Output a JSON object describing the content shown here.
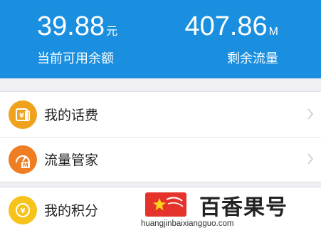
{
  "balance": {
    "value": "39.88",
    "unit": "元",
    "label": "当前可用余额"
  },
  "data_remaining": {
    "value": "407.86",
    "unit": "M",
    "label": "剩余流量"
  },
  "menu_group_1": [
    {
      "label": "我的话费",
      "icon": "phone-bill-icon",
      "color": "#f0a21e"
    },
    {
      "label": "流量管家",
      "icon": "data-manager-icon",
      "color": "#ef7d22"
    }
  ],
  "menu_group_2": [
    {
      "label": "我的积分",
      "icon": "points-icon",
      "color": "#f6c31a"
    }
  ],
  "watermark": {
    "text": "百香果号",
    "url": "huangjinbaixiangguo.com"
  },
  "colors": {
    "header_blue": "#1a8fe0",
    "watermark_red": "#e5322b"
  }
}
